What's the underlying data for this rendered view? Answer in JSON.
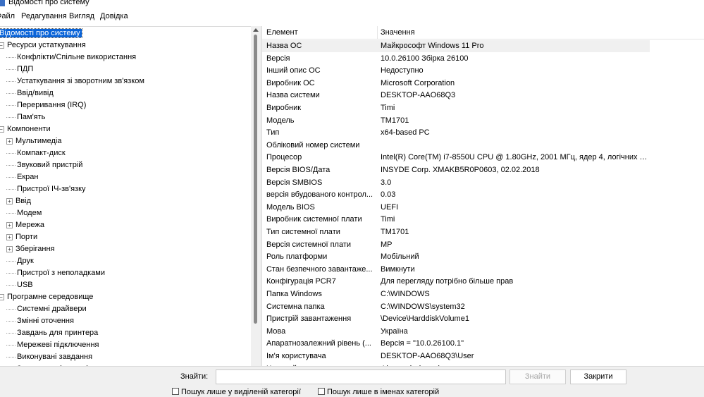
{
  "window": {
    "title": "Відомості про систему"
  },
  "menu": [
    "Файл",
    "Редагування",
    "Вигляд",
    "Довідка"
  ],
  "tree": [
    {
      "label": "Відомості про систему",
      "level": 0,
      "expander": "",
      "selected": true
    },
    {
      "label": "Ресурси устаткування",
      "level": 0,
      "expander": "−"
    },
    {
      "label": "Конфлікти/Спільне використання",
      "level": 1,
      "expander": ""
    },
    {
      "label": "ПДП",
      "level": 1,
      "expander": ""
    },
    {
      "label": "Устаткування зі зворотним зв'язком",
      "level": 1,
      "expander": ""
    },
    {
      "label": "Ввід/вивід",
      "level": 1,
      "expander": ""
    },
    {
      "label": "Переривання (IRQ)",
      "level": 1,
      "expander": ""
    },
    {
      "label": "Пам'ять",
      "level": 1,
      "expander": ""
    },
    {
      "label": "Компоненти",
      "level": 0,
      "expander": "−"
    },
    {
      "label": "Мультимедіа",
      "level": 1,
      "expander": "+"
    },
    {
      "label": "Компакт-диск",
      "level": 1,
      "expander": ""
    },
    {
      "label": "Звуковий пристрій",
      "level": 1,
      "expander": ""
    },
    {
      "label": "Екран",
      "level": 1,
      "expander": ""
    },
    {
      "label": "Пристрої ІЧ-зв'язку",
      "level": 1,
      "expander": ""
    },
    {
      "label": "Ввід",
      "level": 1,
      "expander": "+"
    },
    {
      "label": "Модем",
      "level": 1,
      "expander": ""
    },
    {
      "label": "Мережа",
      "level": 1,
      "expander": "+"
    },
    {
      "label": "Порти",
      "level": 1,
      "expander": "+"
    },
    {
      "label": "Зберігання",
      "level": 1,
      "expander": "+"
    },
    {
      "label": "Друк",
      "level": 1,
      "expander": ""
    },
    {
      "label": "Пристрої з неполадками",
      "level": 1,
      "expander": ""
    },
    {
      "label": "USB",
      "level": 1,
      "expander": ""
    },
    {
      "label": "Програмне середовище",
      "level": 0,
      "expander": "−"
    },
    {
      "label": "Системні драйвери",
      "level": 1,
      "expander": ""
    },
    {
      "label": "Змінні оточення",
      "level": 1,
      "expander": ""
    },
    {
      "label": "Завдань для принтера",
      "level": 1,
      "expander": ""
    },
    {
      "label": "Мережеві підключення",
      "level": 1,
      "expander": ""
    },
    {
      "label": "Виконувані завдання",
      "level": 1,
      "expander": ""
    },
    {
      "label": "Завантажені модулі",
      "level": 1,
      "expander": ""
    }
  ],
  "details": {
    "columns": [
      "Елемент",
      "Значення"
    ],
    "rows": [
      {
        "name": "Назва ОС",
        "value": "Майкрософт Windows 11 Pro",
        "selected": true
      },
      {
        "name": "Версія",
        "value": "10.0.26100 Збірка 26100"
      },
      {
        "name": "Інший опис ОС",
        "value": "Недоступно"
      },
      {
        "name": "Виробник ОС",
        "value": "Microsoft Corporation"
      },
      {
        "name": "Назва системи",
        "value": "DESKTOP-AAO68Q3"
      },
      {
        "name": "Виробник",
        "value": "Timi"
      },
      {
        "name": "Модель",
        "value": "TM1701"
      },
      {
        "name": "Тип",
        "value": "x64-based PC"
      },
      {
        "name": "Обліковий номер системи",
        "value": ""
      },
      {
        "name": "Процесор",
        "value": "Intel(R) Core(TM) i7-8550U CPU @ 1.80GHz, 2001 МГц, ядер 4, логічних п..."
      },
      {
        "name": "Версія BIOS/Дата",
        "value": "INSYDE Corp. XMAKB5R0P0603, 02.02.2018"
      },
      {
        "name": "Версія SMBIOS",
        "value": "3.0"
      },
      {
        "name": "версія вбудованого контрол...",
        "value": "0.03"
      },
      {
        "name": "Модель BIOS",
        "value": "UEFI"
      },
      {
        "name": "Виробник системної плати",
        "value": "Timi"
      },
      {
        "name": "Тип системної плати",
        "value": "TM1701"
      },
      {
        "name": "Версія системної плати",
        "value": "MP"
      },
      {
        "name": "Роль платформи",
        "value": "Мобільний"
      },
      {
        "name": "Стан безпечного завантаже...",
        "value": "Вимкнути"
      },
      {
        "name": "Конфігурація PCR7",
        "value": "Для перегляду потрібно більше прав"
      },
      {
        "name": "Папка Windows",
        "value": "C:\\WINDOWS"
      },
      {
        "name": "Системна папка",
        "value": "C:\\WINDOWS\\system32"
      },
      {
        "name": "Пристрій завантаження",
        "value": "\\Device\\HarddiskVolume1"
      },
      {
        "name": "Мова",
        "value": "Україна"
      },
      {
        "name": "Апаратнозалежний рівень (...",
        "value": "Версія = \"10.0.26100.1\""
      },
      {
        "name": "Ім'я користувача",
        "value": "DESKTOP-AAO68Q3\\User"
      },
      {
        "name": "Часовий пояс",
        "value": "Фінляндія (зима)"
      }
    ]
  },
  "find": {
    "label": "Знайти:",
    "value": "",
    "find_button": "Знайти",
    "close_button": "Закрити",
    "option_selected_category": "Пошук лише у виділеній категорії",
    "option_category_names": "Пошук лише в іменах категорій"
  }
}
